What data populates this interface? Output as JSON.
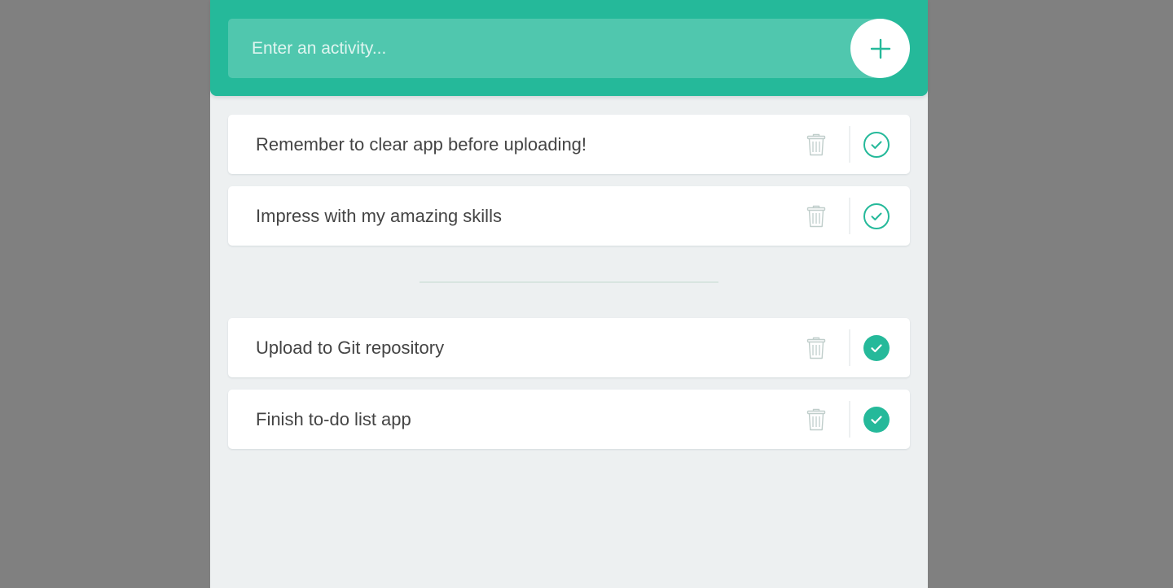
{
  "add_form": {
    "placeholder": "Enter an activity...",
    "button_icon": "plus-icon"
  },
  "todo_items": [
    {
      "text": "Remember to clear app before uploading!",
      "completed": false
    },
    {
      "text": "Impress with my amazing skills",
      "completed": false
    }
  ],
  "completed_items": [
    {
      "text": "Upload to Git repository",
      "completed": true
    },
    {
      "text": "Finish to-do list app",
      "completed": true
    }
  ],
  "icons": {
    "remove": "trash-icon",
    "complete": "check-circle-icon"
  },
  "colors": {
    "accent": "#25b99a",
    "background": "#edf0f1",
    "card": "#ffffff",
    "text": "#444444",
    "trash_icon": "#c0cecb",
    "backdrop": "#808080"
  }
}
